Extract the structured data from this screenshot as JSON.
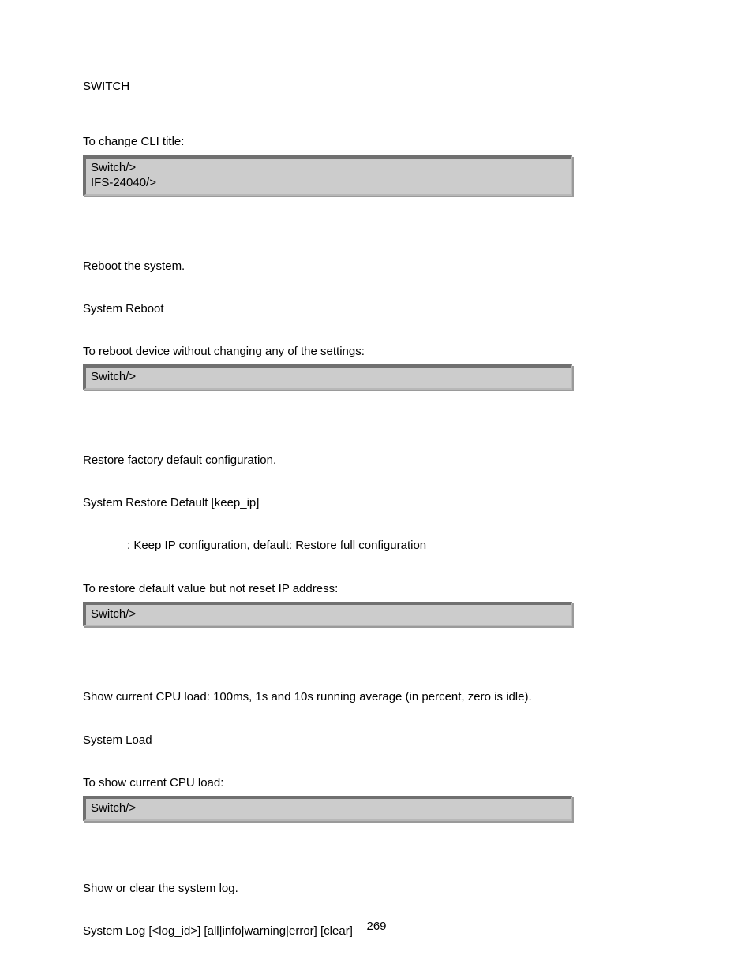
{
  "header": "SWITCH",
  "sec1": {
    "lead": "To change CLI title:",
    "code1": "Switch/>",
    "code2": "IFS-24040/>"
  },
  "sec2": {
    "desc": "Reboot the system.",
    "syntax": "System Reboot",
    "lead": "To reboot device without changing any of the settings:",
    "code1": "Switch/>"
  },
  "sec3": {
    "desc": "Restore factory default configuration.",
    "syntax": "System Restore Default [keep_ip]",
    "param": ": Keep IP configuration, default: Restore full configuration",
    "lead": "To restore default value but not reset IP address:",
    "code1": "Switch/>"
  },
  "sec4": {
    "desc": "Show current CPU load: 100ms, 1s and 10s running average (in percent, zero is idle).",
    "syntax": "System Load",
    "lead": "To show current CPU load:",
    "code1": "Switch/>"
  },
  "sec5": {
    "desc": "Show or clear the system log.",
    "syntax": "System Log [<log_id>] [all|info|warning|error] [clear]"
  },
  "page_number": "269"
}
